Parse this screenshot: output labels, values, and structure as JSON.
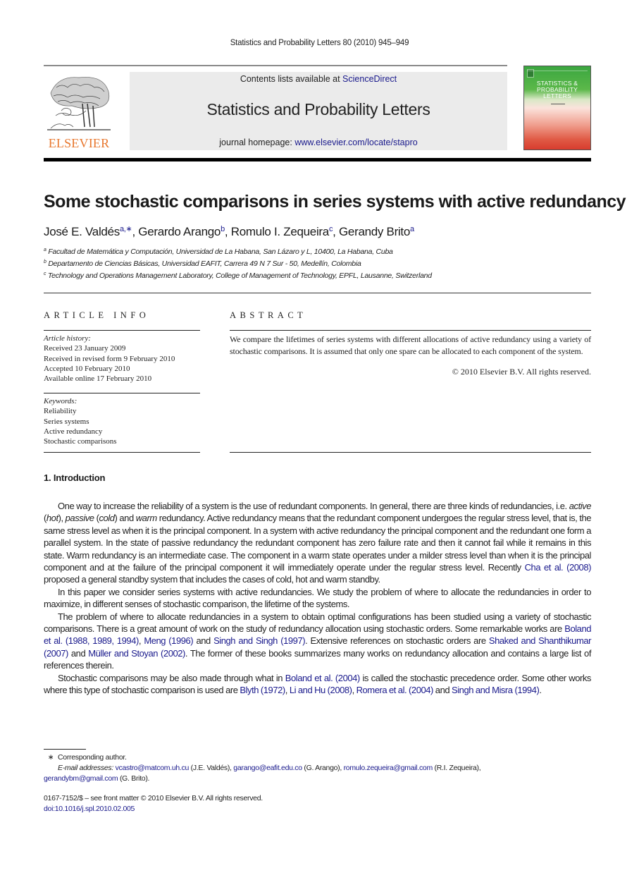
{
  "running_head": "Statistics and Probability Letters 80 (2010) 945–949",
  "publisher": {
    "logo_text": "ELSEVIER",
    "logo_color": "#e8772e"
  },
  "masthead": {
    "contents_prefix": "Contents lists available at ",
    "contents_link": "ScienceDirect",
    "journal_title": "Statistics and Probability Letters",
    "homepage_prefix": "journal homepage: ",
    "homepage_link": "www.elsevier.com/locate/stapro"
  },
  "cover": {
    "title_line1": "STATISTICS &",
    "title_line2": "PROBABILITY",
    "title_line3": "LETTERS"
  },
  "article": {
    "title": "Some stochastic comparisons in series systems with active redundancy",
    "authors": [
      {
        "name": "José E. Valdés",
        "sup": "a,∗",
        "sep": ", "
      },
      {
        "name": "Gerardo Arango",
        "sup": "b",
        "sep": ", "
      },
      {
        "name": "Romulo I. Zequeira",
        "sup": "c",
        "sep": ", "
      },
      {
        "name": "Gerandy Brito",
        "sup": "a",
        "sep": ""
      }
    ],
    "affiliations": [
      {
        "mark": "a",
        "text": "Facultad de Matemática y Computación, Universidad de La Habana, San Lázaro y L, 10400, La Habana, Cuba"
      },
      {
        "mark": "b",
        "text": "Departamento de Ciencias Básicas, Universidad EAFIT, Carrera 49 N 7 Sur - 50, Medellín, Colombia"
      },
      {
        "mark": "c",
        "text": "Technology and Operations Management Laboratory, College of Management of Technology, EPFL, Lausanne, Switzerland"
      }
    ]
  },
  "article_info": {
    "label": "ARTICLE INFO",
    "history_label": "Article history:",
    "history": [
      "Received 23 January 2009",
      "Received in revised form 9 February 2010",
      "Accepted 10 February 2010",
      "Available online 17 February 2010"
    ],
    "keywords_label": "Keywords:",
    "keywords": [
      "Reliability",
      "Series systems",
      "Active redundancy",
      "Stochastic comparisons"
    ]
  },
  "abstract": {
    "label": "ABSTRACT",
    "text": "We compare the lifetimes of series systems with different allocations of active redundancy using a variety of stochastic comparisons. It is assumed that only one spare can be allocated to each component of the system.",
    "copyright": "© 2010 Elsevier B.V. All rights reserved."
  },
  "introduction": {
    "heading": "1.  Introduction",
    "p1": {
      "t1": "One way to increase the reliability of a system is the use of redundant components. In general, there are three kinds of redundancies, i.e. ",
      "i1": "active",
      "t2": " (",
      "i2": "hot",
      "t3": "), ",
      "i3": "passive",
      "t4": " (",
      "i4": "cold",
      "t5": ") and ",
      "i5": "warm",
      "t6": " redundancy. Active redundancy means that the redundant component undergoes the regular stress level, that is, the same stress level as when it is the principal component. In a system with active redundancy the principal component and the redundant one form a parallel system. In the state of passive redundancy the redundant component has zero failure rate and then it cannot fail while it remains in this state. Warm redundancy is an intermediate case. The component in a warm state operates under a milder stress level than when it is the principal component and at the failure of the principal component it will immediately operate under the regular stress level. Recently ",
      "ref1": "Cha et al. (2008)",
      "t7": " proposed a general standby system that includes the cases of cold, hot and warm standby."
    },
    "p2": "In this paper we consider series systems with active redundancies. We study the problem of where to allocate the redundancies in order to maximize, in different senses of stochastic comparison, the lifetime of the systems.",
    "p3": {
      "t1": "The problem of where to allocate redundancies in a system to obtain optimal configurations has been studied using a variety of stochastic comparisons. There is a great amount of work on the study of redundancy allocation using stochastic orders. Some remarkable works are ",
      "ref1": "Boland et al. (1988, 1989, 1994)",
      "t2": ", ",
      "ref2": "Meng (1996)",
      "t3": " and ",
      "ref3": "Singh and Singh (1997)",
      "t4": ". Extensive references on stochastic orders are ",
      "ref4": "Shaked and Shanthikumar (2007)",
      "t5": " and ",
      "ref5": "Müller and Stoyan (2002)",
      "t6": ". The former of these books summarizes many works on redundancy allocation and contains a large list of references therein."
    },
    "p4": {
      "t1": "Stochastic comparisons may be also made through what in ",
      "ref1": "Boland et al. (2004)",
      "t2": " is called the stochastic precedence order. Some other works where this type of stochastic comparison is used are ",
      "ref2": "Blyth (1972)",
      "t3": ", ",
      "ref3": "Li and Hu (2008)",
      "t4": ", ",
      "ref4": "Romera et al. (2004)",
      "t5": " and ",
      "ref5": "Singh and Misra (1994)",
      "t6": "."
    }
  },
  "footnotes": {
    "star": "∗",
    "corresponding": "Corresponding author.",
    "email_label": "E-mail addresses:",
    "emails": [
      {
        "addr": "vcastro@matcom.uh.cu",
        "who": " (J.E. Valdés), "
      },
      {
        "addr": "garango@eafit.edu.co",
        "who": " (G. Arango), "
      },
      {
        "addr": "romulo.zequeira@gmail.com",
        "who": " (R.I. Zequeira),"
      },
      {
        "addr": "gerandybm@gmail.com",
        "who": " (G. Brito)."
      }
    ],
    "front_matter": "0167-7152/$ – see front matter © 2010 Elsevier B.V. All rights reserved.",
    "doi": "doi:10.1016/j.spl.2010.02.005"
  },
  "colors": {
    "link": "#1a1a8c",
    "masthead_bg": "#ebebeb"
  }
}
